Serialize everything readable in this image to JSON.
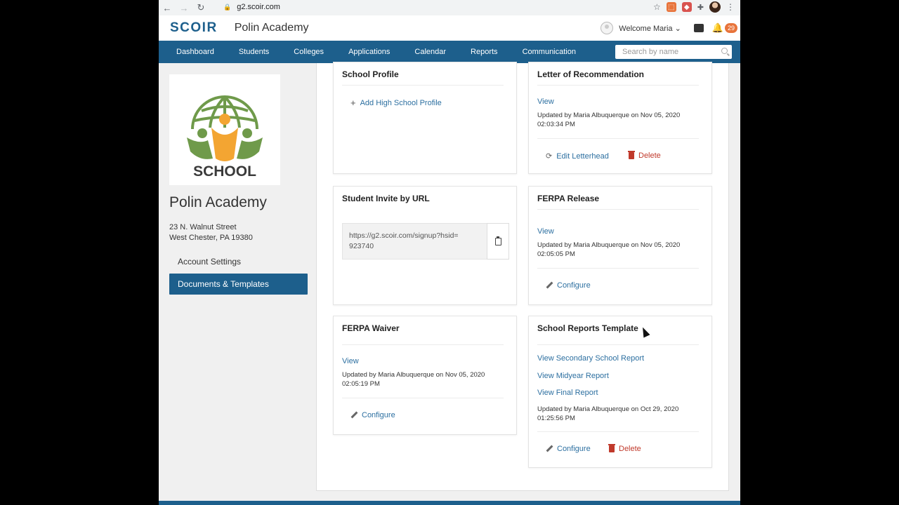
{
  "browser": {
    "url": "g2.scoir.com",
    "back_icon": "arrow-left-icon",
    "forward_icon": "arrow-right-icon",
    "reload_icon": "reload-icon"
  },
  "header": {
    "logo": "SCOIR",
    "school_name": "Polin Academy",
    "welcome": "Welcome Maria",
    "notification_count": "29"
  },
  "nav": {
    "items": [
      "Dashboard",
      "Students",
      "Colleges",
      "Applications",
      "Calendar",
      "Reports",
      "Communication"
    ],
    "search_placeholder": "Search by name"
  },
  "sidebar": {
    "logo_text": "SCHOOL",
    "name": "Polin Academy",
    "address_line1": "23 N. Walnut Street",
    "address_line2": "West Chester, PA 19380",
    "links": [
      "Account Settings",
      "Documents & Templates"
    ],
    "active_link": "Documents & Templates"
  },
  "cards": {
    "school_profile": {
      "title": "School Profile",
      "add_label": "Add High School Profile"
    },
    "letter": {
      "title": "Letter of Recommendation",
      "view": "View",
      "meta1": "Updated by Maria Albuquerque on Nov 05, 2020",
      "meta2": "02:03:34 PM",
      "edit": "Edit Letterhead",
      "delete": "Delete"
    },
    "invite": {
      "title": "Student Invite by URL",
      "url": "https://g2.scoir.com/signup?hsid=923740"
    },
    "ferpa_release": {
      "title": "FERPA Release",
      "view": "View",
      "meta1": "Updated by Maria Albuquerque on Nov 05, 2020",
      "meta2": "02:05:05 PM",
      "configure": "Configure"
    },
    "ferpa_waiver": {
      "title": "FERPA Waiver",
      "view": "View",
      "meta1": "Updated by Maria Albuquerque on Nov 05, 2020",
      "meta2": "02:05:19 PM",
      "configure": "Configure"
    },
    "school_reports": {
      "title": "School Reports Template",
      "view_secondary": "View Secondary School Report",
      "view_midyear": "View Midyear Report",
      "view_final": "View Final Report",
      "meta1": "Updated by Maria Albuquerque on Oct 29, 2020",
      "meta2": "01:25:56 PM",
      "configure": "Configure",
      "delete": "Delete"
    }
  },
  "colors": {
    "brand_blue": "#1d5f8c",
    "link_blue": "#2c6fa0",
    "delete_red": "#c0392b",
    "badge_orange": "#e8743b"
  }
}
